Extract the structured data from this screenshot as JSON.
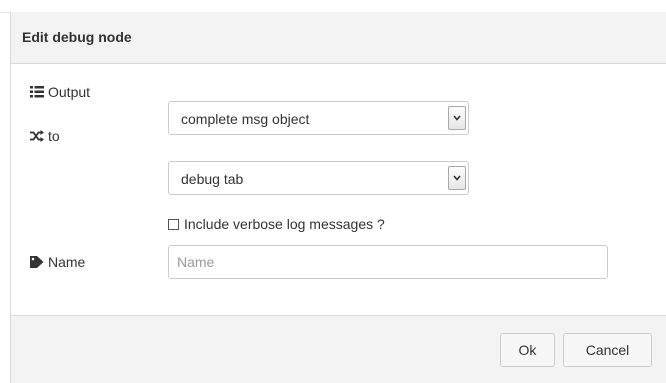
{
  "dialog": {
    "title": "Edit debug node"
  },
  "form": {
    "output": {
      "label": "Output",
      "icon": "list-icon",
      "selected": "complete msg object"
    },
    "to": {
      "label": "to",
      "icon": "random-icon",
      "selected": "debug tab"
    },
    "verbose": {
      "label": "Include verbose log messages ?",
      "checked": false
    },
    "name": {
      "label": "Name",
      "icon": "tag-icon",
      "value": "",
      "placeholder": "Name"
    }
  },
  "footer": {
    "ok_label": "Ok",
    "cancel_label": "Cancel"
  }
}
